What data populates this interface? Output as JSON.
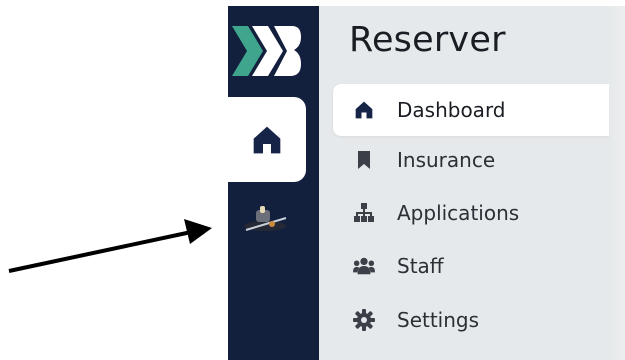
{
  "app": {
    "title": "Reserver"
  },
  "nav": {
    "items": [
      {
        "label": "Dashboard",
        "icon": "home-icon",
        "active": true
      },
      {
        "label": "Insurance",
        "icon": "bookmark-icon",
        "active": false
      },
      {
        "label": "Applications",
        "icon": "sitemap-icon",
        "active": false
      },
      {
        "label": "Staff",
        "icon": "users-icon",
        "active": false
      },
      {
        "label": "Settings",
        "icon": "gear-icon",
        "active": false
      }
    ]
  },
  "rail": {
    "items": [
      {
        "icon": "home-icon",
        "active": true
      },
      {
        "icon": "stamp-icon",
        "active": false
      }
    ]
  },
  "colors": {
    "rail_background": "#121f3d",
    "panel_background": "#e6e9eb",
    "active_item_background": "#ffffff",
    "logo_teal": "#3fa58d",
    "icon_navy": "#162447"
  }
}
